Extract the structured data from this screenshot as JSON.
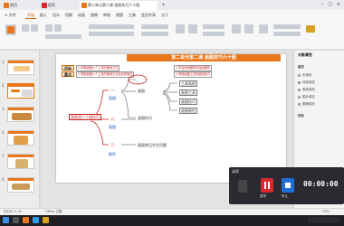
{
  "browser": {
    "tabs": [
      {
        "label": "首页",
        "active": false
      },
      {
        "label": "稻壳",
        "active": false
      },
      {
        "label": "第二单元第二课 画图技巧六十图",
        "active": true
      }
    ],
    "new_tab": "+",
    "window_controls": [
      "–",
      "□",
      "×"
    ]
  },
  "menu": {
    "file": "≡ 文件",
    "items": [
      "开始",
      "插入",
      "设计",
      "切换",
      "动画",
      "放映",
      "审阅",
      "视图",
      "工具",
      "会员专享"
    ],
    "active_index": 0,
    "search": "查找"
  },
  "slide": {
    "title": "第二单元第二课 画图技巧六十图",
    "goals": [
      {
        "label": "目标",
        "items": [
          "1.掌握画图六个工具的使用方法",
          "2.学会用画图软件绘画图形"
        ]
      },
      {
        "label": "重点",
        "items": [
          "1.掌握画图六个工具的使用方法及具体操作",
          "2.掌握画图工具的使用技巧"
        ]
      }
    ],
    "root_node": "画图里六十图技巧",
    "branches": [
      "一、",
      "二、",
      "三、"
    ],
    "mid_nodes": [
      "画图",
      "画图技巧",
      "画图常见学生问题"
    ],
    "leaf_nodes": [
      "工具画图",
      "画图工具",
      "画图技巧",
      "画图颜色"
    ],
    "side_nodes": [
      "画图",
      "画图",
      "颜色"
    ]
  },
  "right_panel": {
    "title": "对象属性",
    "rows": [
      "填充",
      "无填充",
      "纯色填充",
      "渐变填充",
      "图片填充",
      "图案填充",
      "线条"
    ]
  },
  "status_bar": {
    "slide_info": "幻灯片 2 / 8",
    "theme": "Office 主题",
    "zoom": "73%"
  },
  "recorder": {
    "title": "录屏",
    "time": "00:00:00",
    "buttons": [
      "暂停",
      "停止"
    ]
  }
}
